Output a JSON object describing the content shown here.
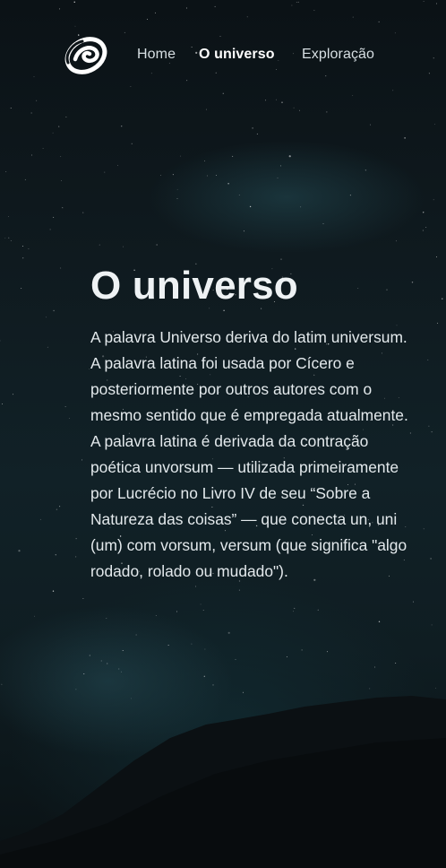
{
  "nav": {
    "logo_alt": "logo",
    "items": [
      {
        "label": "Home",
        "active": false
      },
      {
        "label": "O universo",
        "active": true
      },
      {
        "label": "Exploração",
        "active": false
      }
    ]
  },
  "main": {
    "title": "O universo",
    "body": "A palavra Universo deriva do latim universum. A palavra latina foi usada por Cícero e posteriormente por outros autores com o mesmo sentido que é empregada atualmente. A palavra latina é derivada da contração poética unvorsum — utilizada primeiramente por Lucrécio no Livro IV de seu “Sobre a Natureza das coisas” — que conecta un, uni (um) com vorsum, versum (que significa \"algo rodado, rolado ou mudado\")."
  },
  "theme": {
    "background": "#0d1418",
    "text": "#e3e9ec",
    "accent": "#ffffff"
  }
}
